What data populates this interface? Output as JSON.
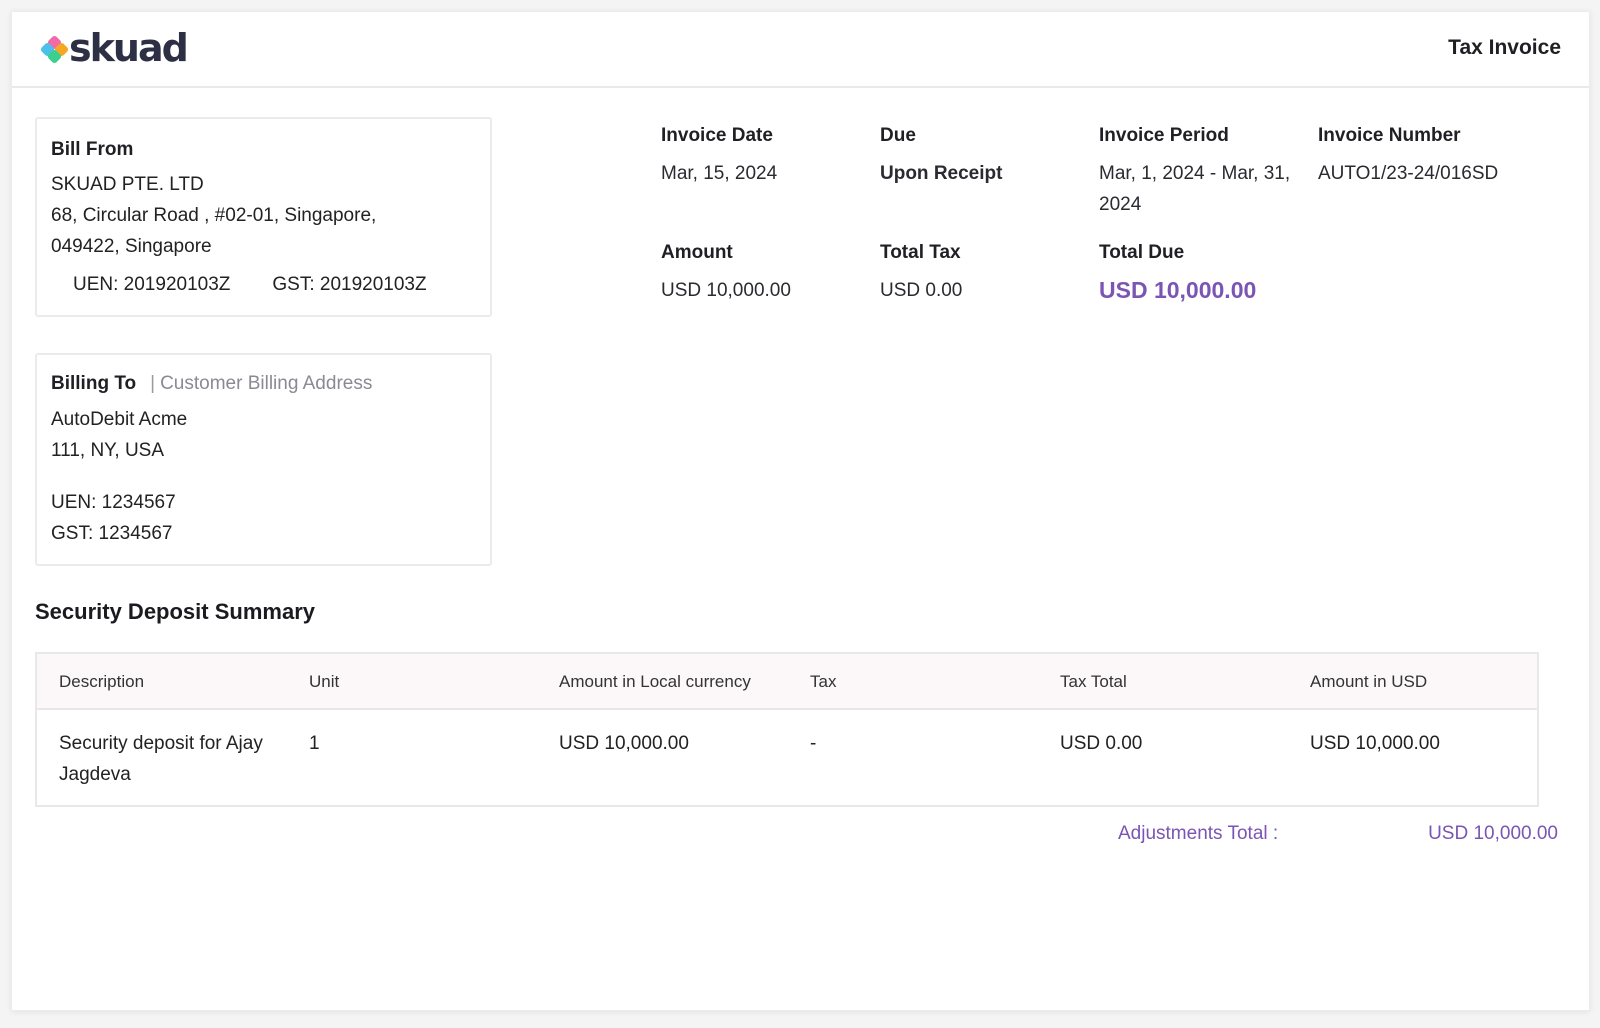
{
  "header": {
    "logo_text": "skuad",
    "doc_title": "Tax Invoice"
  },
  "bill_from": {
    "title": "Bill From",
    "lines": [
      "SKUAD PTE. LTD",
      "68, Circular Road , #02-01, Singapore,",
      "049422, Singapore"
    ],
    "uen": "UEN: 201920103Z",
    "gst": "GST: 201920103Z"
  },
  "billing_to": {
    "title": "Billing To",
    "subtitle": "Customer Billing Address",
    "lines": [
      "AutoDebit Acme",
      "111, NY, USA"
    ],
    "uen": "UEN: 1234567",
    "gst": "GST: 1234567"
  },
  "meta": {
    "invoice_date": {
      "label": "Invoice Date",
      "value": "Mar, 15, 2024"
    },
    "due": {
      "label": "Due",
      "value": "Upon Receipt"
    },
    "invoice_period": {
      "label": "Invoice Period",
      "value": "Mar, 1, 2024 - Mar, 31, 2024"
    },
    "invoice_number": {
      "label": "Invoice Number",
      "value": "AUTO1/23-24/016SD"
    },
    "amount": {
      "label": "Amount",
      "value": "USD 10,000.00"
    },
    "total_tax": {
      "label": "Total Tax",
      "value": "USD 0.00"
    },
    "total_due": {
      "label": "Total Due",
      "value": "USD 10,000.00"
    }
  },
  "summary": {
    "title": "Security Deposit Summary",
    "columns": [
      "Description",
      "Unit",
      "Amount in Local currency",
      "Tax",
      "Tax Total",
      "Amount in USD"
    ],
    "rows": [
      [
        "Security deposit for Ajay Jagdeva",
        "1",
        "USD 10,000.00",
        "-",
        "USD 0.00",
        "USD 10,000.00"
      ]
    ],
    "adjustments_label": "Adjustments Total :",
    "adjustments_value": "USD 10,000.00"
  },
  "colors": {
    "accent": "#7a55b3",
    "logo_text": "#2d2f45",
    "logo_mark": [
      "#f06ba8",
      "#4cc0e8",
      "#f5a623",
      "#3ccf8e"
    ]
  }
}
